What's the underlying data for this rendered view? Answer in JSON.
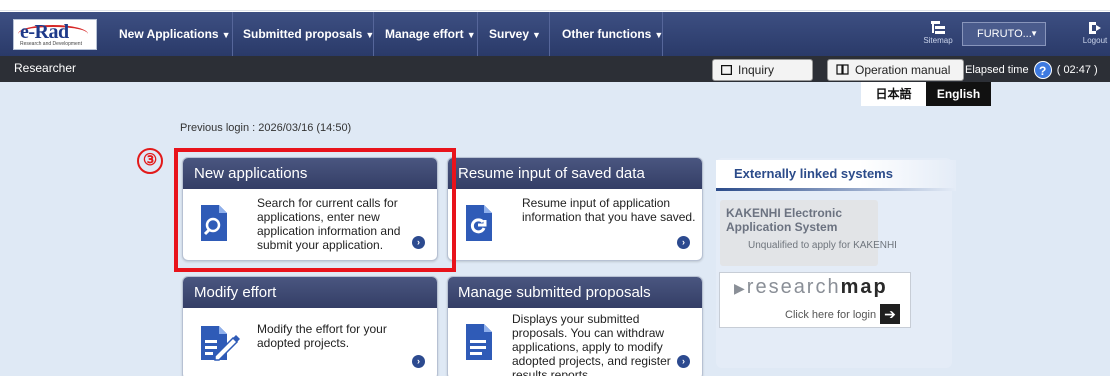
{
  "header": {
    "logo_text": "e-Rad",
    "logo_subtext": "Research and Development",
    "nav": [
      {
        "label": "New Applications"
      },
      {
        "label": "Submitted proposals"
      },
      {
        "label": "Manage effort"
      },
      {
        "label": "Survey"
      },
      {
        "label": "Other functions"
      }
    ],
    "sitemap_label": "Sitemap",
    "user_name": "FURUTO...",
    "logout_label": "Logout"
  },
  "subbar": {
    "role": "Researcher",
    "inquiry_label": "Inquiry",
    "manual_label": "Operation manual",
    "elapsed_label": "Elapsed time",
    "elapsed_value": "( 02:47 )"
  },
  "language": {
    "japanese": "日本語",
    "english": "English"
  },
  "previous_login": "Previous login : 2026/03/16 (14:50)",
  "annotation": {
    "marker": "③"
  },
  "cards": [
    {
      "title": "New applications",
      "description": "Search for current calls for applications, enter new application information and submit your application."
    },
    {
      "title": "Resume input of saved data",
      "description": "Resume input of application information that you have saved."
    },
    {
      "title": "Modify effort",
      "description": "Modify the effort for your adopted projects."
    },
    {
      "title": "Manage submitted proposals",
      "description": "Displays your submitted proposals. You can withdraw applications, apply to modify adopted projects, and register results reports."
    }
  ],
  "external": {
    "heading": "Externally linked systems",
    "kakenhi_title": "KAKENHI Electronic Application System",
    "kakenhi_note": "Unqualified to apply for KAKENHI",
    "researchmap_light": "research",
    "researchmap_bold": "map",
    "researchmap_login": "Click here for login"
  },
  "colors": {
    "navbar": "#34406e",
    "accent_red": "#e8131b",
    "card_header": "#3d4874"
  }
}
